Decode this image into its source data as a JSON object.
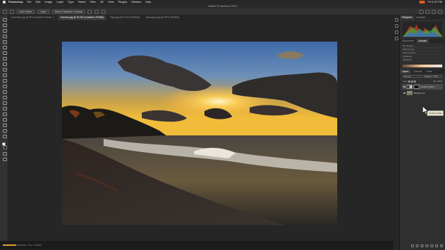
{
  "menubar": {
    "app": "Photoshop",
    "items": [
      "File",
      "Edit",
      "Image",
      "Layer",
      "Type",
      "Select",
      "Filter",
      "3D",
      "View",
      "Plugins",
      "Window",
      "Help"
    ],
    "clock": "Fri 2:07 PM"
  },
  "window": {
    "title": "Adobe Photoshop 2021"
  },
  "options": {
    "auto_select_label": "Auto-Select",
    "layer_label": "Layer",
    "transform_label": "Show Transform Controls"
  },
  "tabs": [
    {
      "label": "Colorado.jpg @ 50% (Classic Portrait...)",
      "active": false
    },
    {
      "label": "Sunrise.jpg @ 33.3% (Gradient, RGB/8)",
      "active": true
    },
    {
      "label": "Tiger.jpg @ 33.3% (RGB/8)",
      "active": false
    },
    {
      "label": "Seascape.jpg @ 50% (RGB/8)",
      "active": false
    }
  ],
  "status": {
    "text": "Doc: 0 bytes",
    "progress": 0.55
  },
  "panels": {
    "tabs_top": [
      "Histogram",
      "Navigator"
    ],
    "tabs_mid": [
      "Adjustments",
      "Libraries"
    ],
    "adjust_rows": [
      "My Libraries",
      "Filter by type",
      "Color Themes",
      "Gradients",
      "Swatches"
    ],
    "tabs_layers": [
      "Layers",
      "Channels",
      "Paths"
    ],
    "blend_mode": "Normal",
    "opacity_label": "Opacity: 100%",
    "lock_label": "Lock:",
    "fill_label": "Fill: 100%",
    "layers": [
      {
        "name": "Gradient Map 1",
        "thumb": "black",
        "selected": true
      },
      {
        "name": "Background",
        "thumb": "photo",
        "selected": false
      }
    ],
    "tooltip": "Gradient Map"
  },
  "colors": {
    "accent": "#e0a326",
    "panel_bg": "#2f2f2f",
    "workspace_bg": "#262626"
  }
}
